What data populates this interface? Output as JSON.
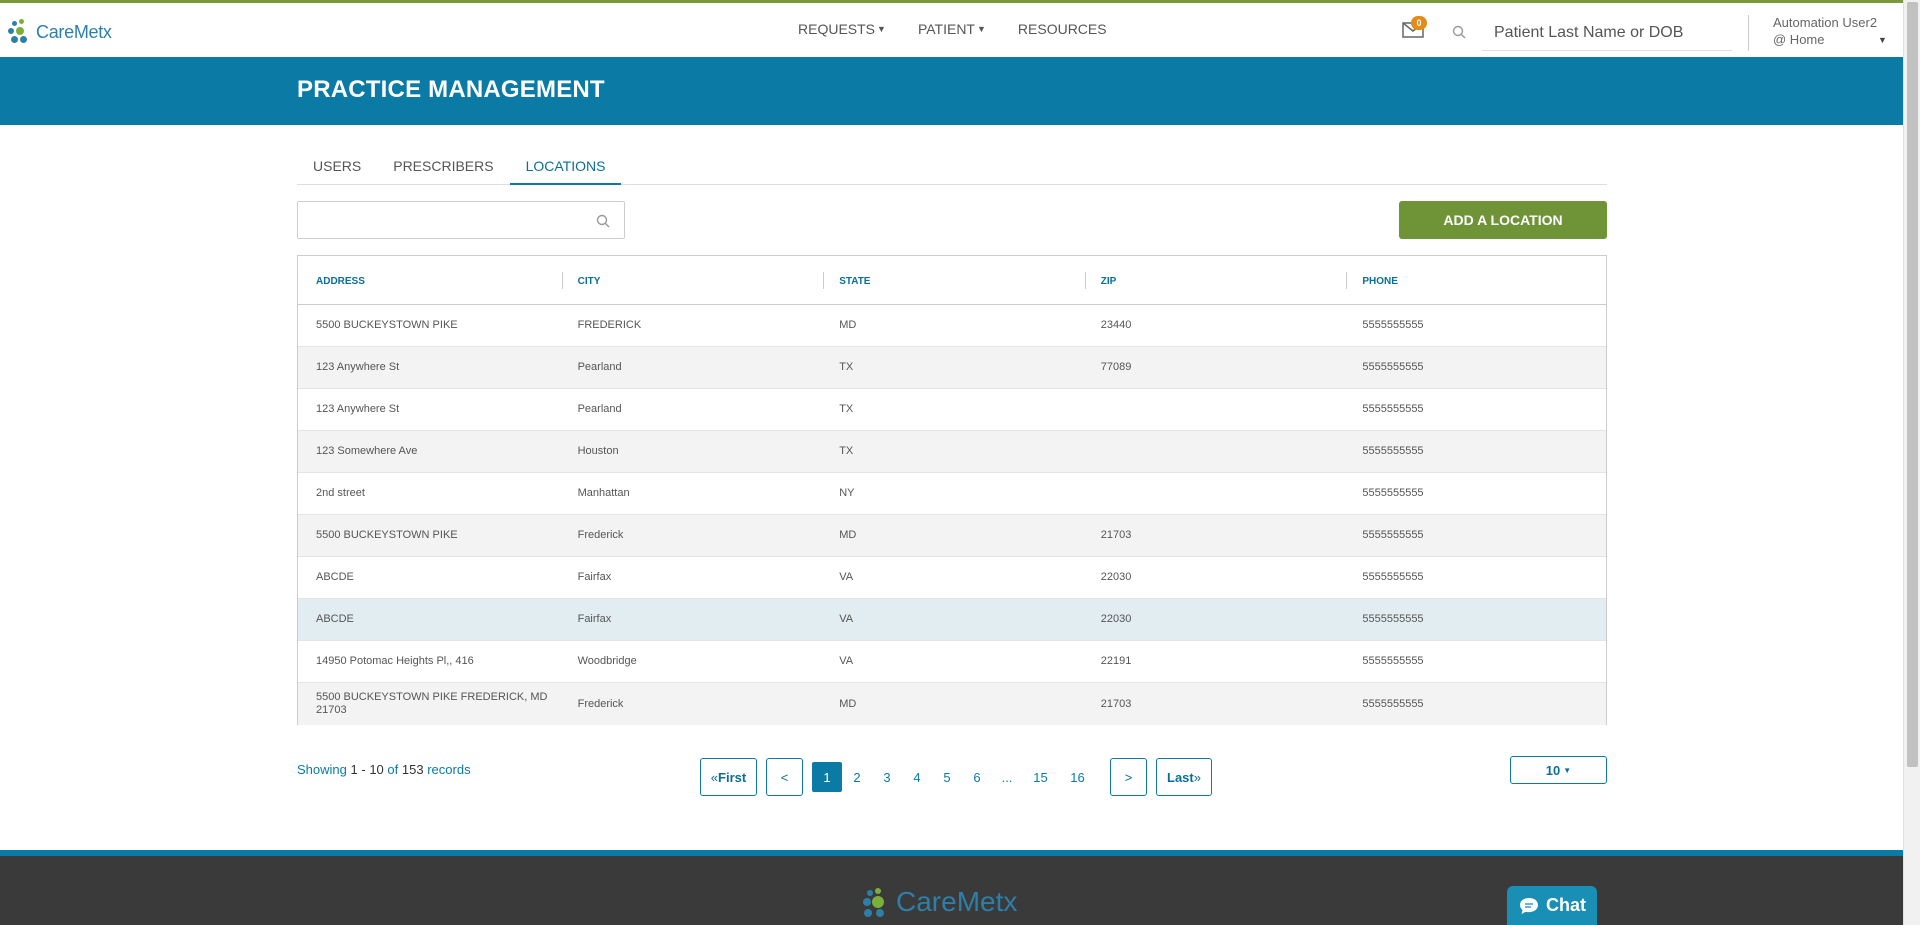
{
  "app": {
    "logo_text": "CareMetx"
  },
  "nav": {
    "items": [
      {
        "label": "REQUESTS",
        "has_caret": true
      },
      {
        "label": "PATIENT",
        "has_caret": true
      },
      {
        "label": "RESOURCES",
        "has_caret": false
      }
    ],
    "mail_count": "0",
    "search_placeholder": "Patient Last Name or DOB",
    "user_name": "Automation User2",
    "user_location": "@ Home"
  },
  "header": {
    "title": "PRACTICE MANAGEMENT"
  },
  "tabs": [
    {
      "label": "USERS",
      "active": false
    },
    {
      "label": "PRESCRIBERS",
      "active": false
    },
    {
      "label": "LOCATIONS",
      "active": true
    }
  ],
  "toolbar": {
    "filter_value": "",
    "add_label": "ADD A LOCATION"
  },
  "table": {
    "columns": [
      "ADDRESS",
      "CITY",
      "STATE",
      "ZIP",
      "PHONE"
    ],
    "rows": [
      [
        "5500 BUCKEYSTOWN PIKE",
        "FREDERICK",
        "MD",
        "23440",
        "5555555555"
      ],
      [
        "123 Anywhere St",
        "Pearland",
        "TX",
        "77089",
        "5555555555"
      ],
      [
        "123 Anywhere St",
        "Pearland",
        "TX",
        "",
        "5555555555"
      ],
      [
        "123 Somewhere Ave",
        "Houston",
        "TX",
        "",
        "5555555555"
      ],
      [
        "2nd street",
        "Manhattan",
        "NY",
        "",
        "5555555555"
      ],
      [
        "5500 BUCKEYSTOWN PIKE",
        "Frederick",
        "MD",
        "21703",
        "5555555555"
      ],
      [
        "ABCDE",
        "Fairfax",
        "VA",
        "22030",
        "5555555555"
      ],
      [
        "ABCDE",
        "Fairfax",
        "VA",
        "22030",
        "5555555555"
      ],
      [
        "14950 Potomac Heights Pl,, 416",
        "Woodbridge",
        "VA",
        "22191",
        "5555555555"
      ],
      [
        "5500 BUCKEYSTOWN PIKE FREDERICK, MD 21703",
        "Frederick",
        "MD",
        "21703",
        "5555555555"
      ]
    ]
  },
  "pagination": {
    "showing_prefix": "Showing",
    "range_start": "1",
    "range_sep": "-",
    "range_end": "10",
    "of_label": "of",
    "total": "153",
    "records_label": "records",
    "first_label": "First",
    "prev_label": "<",
    "pages": [
      "1",
      "2",
      "3",
      "4",
      "5",
      "6",
      "...",
      "15",
      "16"
    ],
    "current_page": "1",
    "next_label": ">",
    "last_label": "Last",
    "page_size": "10"
  },
  "footer": {
    "logo_text": "CareMetx",
    "chat_label": "Chat"
  },
  "colors": {
    "brand_blue": "#0b7ba6",
    "brand_green": "#6e9437",
    "badge_orange": "#e58b1a"
  }
}
